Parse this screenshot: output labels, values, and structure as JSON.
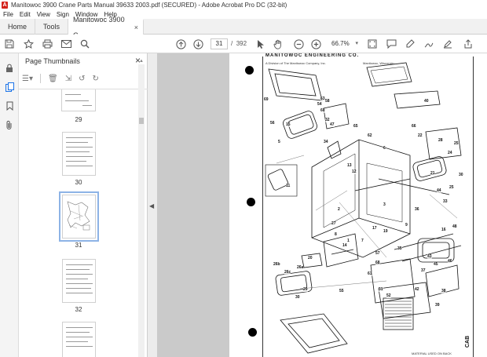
{
  "window": {
    "title": "Manitowoc 3900 Crane Parts Manual 39633 2003.pdf (SECURED) - Adobe Acrobat Pro DC (32-bit)"
  },
  "menu": [
    "File",
    "Edit",
    "View",
    "Sign",
    "Window",
    "Help"
  ],
  "tabs": {
    "home": "Home",
    "tools": "Tools",
    "document": "Manitowoc 3900 C...",
    "document_close": "×"
  },
  "toolbar": {
    "current_page": "31",
    "page_separator": "/",
    "total_pages": "392",
    "zoom": "66.7%"
  },
  "thumbnail_panel": {
    "title": "Page Thumbnails",
    "close": "×",
    "thumbnails": [
      {
        "label": "29",
        "selected": false
      },
      {
        "label": "30",
        "selected": false
      },
      {
        "label": "31",
        "selected": true
      },
      {
        "label": "32",
        "selected": false
      }
    ]
  },
  "document_page": {
    "header": "MANITOWOC ENGINEERING CO.",
    "subheader": "A Division of The Manitowoc Company, Inc.",
    "location": "Manitowoc, Wisconsin",
    "cab_label": "CAB",
    "footer_label": "MATERIAL USED ON BACK",
    "part_numbers": [
      "69",
      "56",
      "15",
      "54",
      "60",
      "63",
      "58",
      "32",
      "47",
      "5",
      "34",
      "65",
      "62",
      "66",
      "40",
      "11",
      "30",
      "28",
      "24",
      "6",
      "25",
      "22",
      "13",
      "12",
      "44",
      "36",
      "2",
      "3",
      "8",
      "1",
      "7",
      "27",
      "17",
      "19",
      "9",
      "33",
      "25",
      "21",
      "16",
      "48",
      "43",
      "45",
      "46",
      "51",
      "52",
      "38",
      "42",
      "39",
      "37",
      "35",
      "26b",
      "26c",
      "26a",
      "29",
      "30",
      "20",
      "61",
      "68",
      "57",
      "14",
      "55"
    ]
  },
  "colors": {
    "accent": "#1b73e8",
    "acrobat_red": "#d4231c",
    "viewer_background": "#cacaca"
  }
}
